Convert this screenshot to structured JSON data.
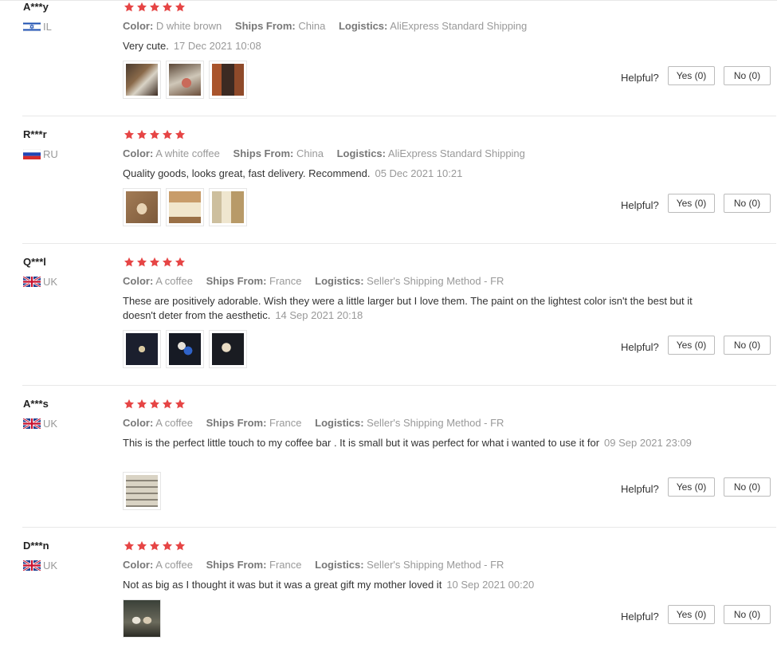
{
  "labels": {
    "color": "Color:",
    "ships_from": "Ships From:",
    "logistics": "Logistics:",
    "helpful": "Helpful?"
  },
  "colors": {
    "star": "#e64545",
    "label": "#777777",
    "value": "#999999"
  },
  "reviews": [
    {
      "user": "A***y",
      "country": "IL",
      "flag": "flag-israel",
      "rating": 5,
      "color": "D white brown",
      "ships_from": "China",
      "logistics": "AliExpress Standard Shipping",
      "text": "Very cute.",
      "date": "17 Dec 2021 10:08",
      "photos": [
        "photo-1",
        "photo-2",
        "photo-3"
      ],
      "yes": "Yes (0)",
      "no": "No (0)"
    },
    {
      "user": "R***r",
      "country": "RU",
      "flag": "flag-russia",
      "rating": 5,
      "color": "A white coffee",
      "ships_from": "China",
      "logistics": "AliExpress Standard Shipping",
      "text": "Quality goods, looks great, fast delivery. Recommend.",
      "date": "05 Dec 2021 10:21",
      "photos": [
        "photo-1",
        "photo-2",
        "photo-3"
      ],
      "yes": "Yes (0)",
      "no": "No (0)"
    },
    {
      "user": "Q***l",
      "country": "UK",
      "flag": "flag-uk",
      "rating": 5,
      "color": "A coffee",
      "ships_from": "France",
      "logistics": "Seller's Shipping Method - FR",
      "text": "These are positively adorable. Wish they were a little larger but I love them. The paint on the lightest color isn't the best but it doesn't deter from the aesthetic.",
      "date": "14 Sep 2021 20:18",
      "photos": [
        "photo-1",
        "photo-2",
        "photo-3"
      ],
      "yes": "Yes (0)",
      "no": "No (0)"
    },
    {
      "user": "A***s",
      "country": "UK",
      "flag": "flag-uk",
      "rating": 5,
      "color": "A coffee",
      "ships_from": "France",
      "logistics": "Seller's Shipping Method - FR",
      "text": "This is the perfect little touch to my coffee bar . It is small but it was perfect for what i wanted to use it for",
      "date": "09 Sep 2021 23:09",
      "photos": [
        "photo-1"
      ],
      "yes": "Yes (0)",
      "no": "No (0)"
    },
    {
      "user": "D***n",
      "country": "UK",
      "flag": "flag-uk",
      "rating": 5,
      "color": "A coffee",
      "ships_from": "France",
      "logistics": "Seller's Shipping Method - FR",
      "text": "Not as big as I thought it was but it was a great gift my mother loved it",
      "date": "10 Sep 2021 00:20",
      "photos": [
        "photo-1"
      ],
      "yes": "Yes (0)",
      "no": "No (0)"
    }
  ]
}
